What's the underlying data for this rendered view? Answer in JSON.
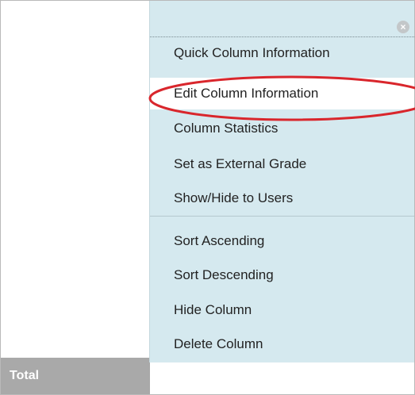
{
  "menu": {
    "close_icon": "close-icon",
    "items": [
      {
        "label": "Quick Column Information"
      },
      {
        "label": "Edit Column Information",
        "active": true
      },
      {
        "label": "Column Statistics"
      },
      {
        "label": "Set as External Grade"
      },
      {
        "label": "Show/Hide to Users"
      },
      {
        "label": "Sort Ascending"
      },
      {
        "label": "Sort Descending"
      },
      {
        "label": "Hide Column"
      },
      {
        "label": "Delete Column"
      }
    ]
  },
  "grid": {
    "total_label": "Total"
  },
  "annotation": {
    "highlight_color": "#d9262c"
  },
  "colors": {
    "menu_background": "#d5e9ef",
    "active_item_background": "#ffffff",
    "total_background": "#a9a9a9"
  }
}
